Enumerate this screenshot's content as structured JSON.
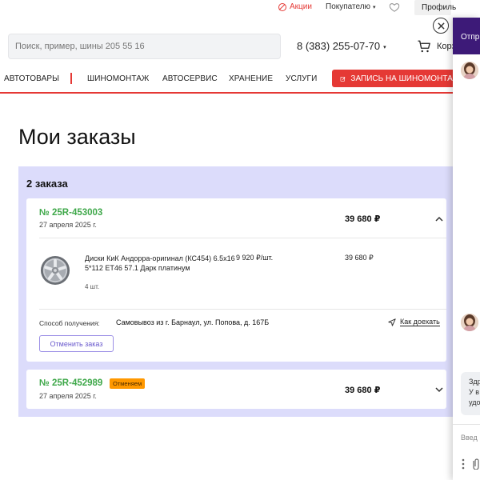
{
  "topbar": {
    "promo_label": "Акции",
    "buyer_label": "Покупателю",
    "buyer_caret": "▾",
    "profile_label": "Профиль"
  },
  "header": {
    "search_placeholder": "Поиск, пример, шины 205 55 16",
    "phone": "8 (383) 255-07-70",
    "phone_caret": "▾",
    "cart_label": "Корзина"
  },
  "nav": {
    "items": [
      "АВТОТОВАРЫ",
      "ШИНОМОНТАЖ",
      "АВТОСЕРВИС",
      "ХРАНЕНИЕ",
      "УСЛУГИ"
    ],
    "cta_label": "ЗАПИСЬ НА ШИНОМОНТАЖ"
  },
  "page": {
    "title": "Мои заказы",
    "orders_count": "2 заказа"
  },
  "orders": [
    {
      "number": "№ 25R-453003",
      "date": "27 апреля 2025 г.",
      "sum": "39 680 ₽",
      "expanded": true,
      "item": {
        "name": "Диски КиК Андорра-оригинал (КС454) 6.5x16 5*112 ET46 57.1 Дарк платинум",
        "unit_price": "9 920 ₽/шт.",
        "total": "39 680 ₽",
        "qty": "4 шт."
      },
      "delivery_label": "Способ получения:",
      "delivery_value": "Самовывоз из г. Барнаул, ул. Попова, д. 167Б",
      "route_label": "Как доехать",
      "cancel_label": "Отменить заказ"
    },
    {
      "number": "№ 25R-452989",
      "status": "Отменяем",
      "date": "27 апреля 2025 г.",
      "sum": "39 680 ₽",
      "expanded": false
    }
  ],
  "chat": {
    "header_label": "Отпр",
    "bubble_line1": "Здр",
    "bubble_line2": "У в",
    "bubble_line3": "удо",
    "input_placeholder": "Введ"
  },
  "colors": {
    "accent_red": "#e53935",
    "order_green": "#3fa84a",
    "panel_lavender": "#dcdcfb",
    "status_orange": "#ff9800",
    "chat_purple": "#3d1a78"
  }
}
